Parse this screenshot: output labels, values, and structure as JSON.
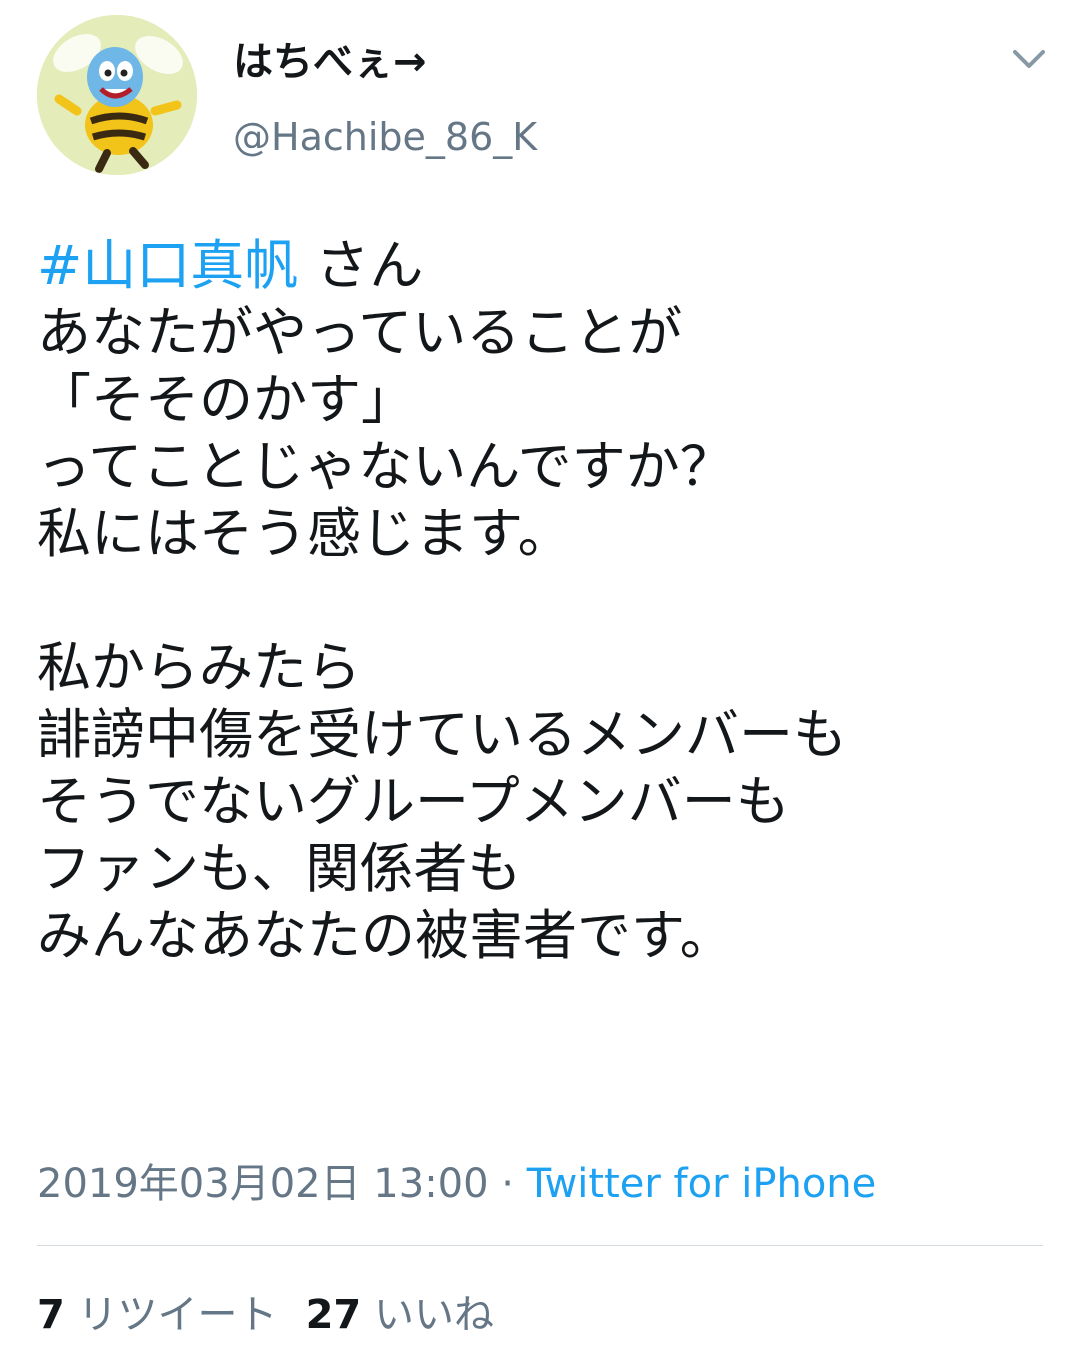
{
  "header": {
    "display_name": "はちべぇ→",
    "handle": "@Hachibe_86_K",
    "menu_icon": "chevron-down-icon",
    "avatar_icon": "bee-character-avatar"
  },
  "tweet": {
    "hashtag": "#山口真帆",
    "first_line_rest": " さん",
    "lines": [
      "あなたがやっていることが",
      "「そそのかす」",
      "ってことじゃないんですか？",
      "私にはそう感じます。",
      "",
      "私からみたら",
      "誹謗中傷を受けているメンバーも",
      "そうでないグループメンバーも",
      "ファンも、関係者も",
      "みんなあなたの被害者です。"
    ]
  },
  "meta": {
    "timestamp": "2019年03月02日 13:00",
    "separator": " · ",
    "source": "Twitter for iPhone"
  },
  "stats": {
    "retweet_count": "7",
    "retweet_label": "リツイート",
    "like_count": "27",
    "like_label": "いいね"
  },
  "colors": {
    "link": "#1da1f2",
    "secondary_text": "#657786",
    "primary_text": "#14171a",
    "divider": "#d4dbe0"
  }
}
